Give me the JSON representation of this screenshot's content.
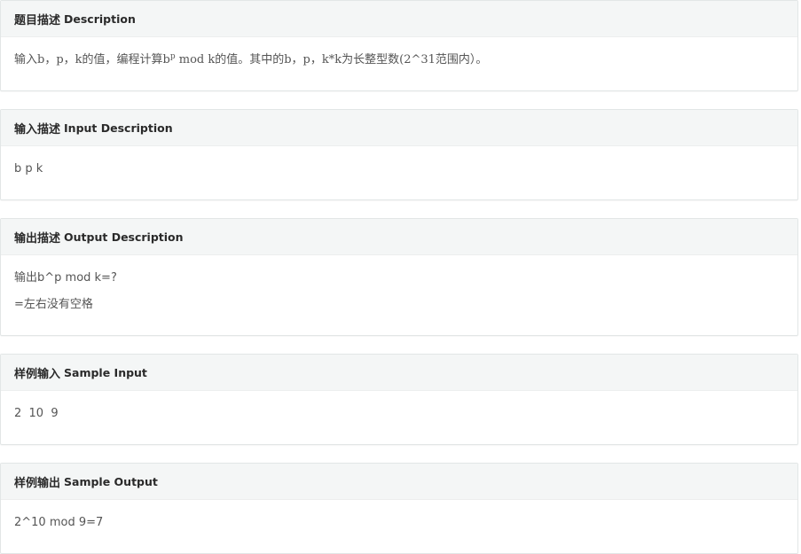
{
  "sections": [
    {
      "title_cn": "题目描述",
      "title_en": "Description",
      "lines": [
        {
          "before_sup": "输入b，p，k的值，编程计算b",
          "sup": "p",
          "after_sup": " mod k的值。其中的b，p，k*k为长整型数(2^31范围内）。"
        }
      ]
    },
    {
      "title_cn": "输入描述",
      "title_en": "Input Description",
      "lines": [
        "b p k"
      ]
    },
    {
      "title_cn": "输出描述",
      "title_en": "Output Description",
      "lines": [
        "输出b^p mod k=?",
        "=左右没有空格"
      ]
    },
    {
      "title_cn": "样例输入",
      "title_en": "Sample Input",
      "lines": [
        "2  10  9"
      ]
    },
    {
      "title_cn": "样例输出",
      "title_en": "Sample Output",
      "lines": [
        "2^10 mod 9=7"
      ]
    }
  ]
}
